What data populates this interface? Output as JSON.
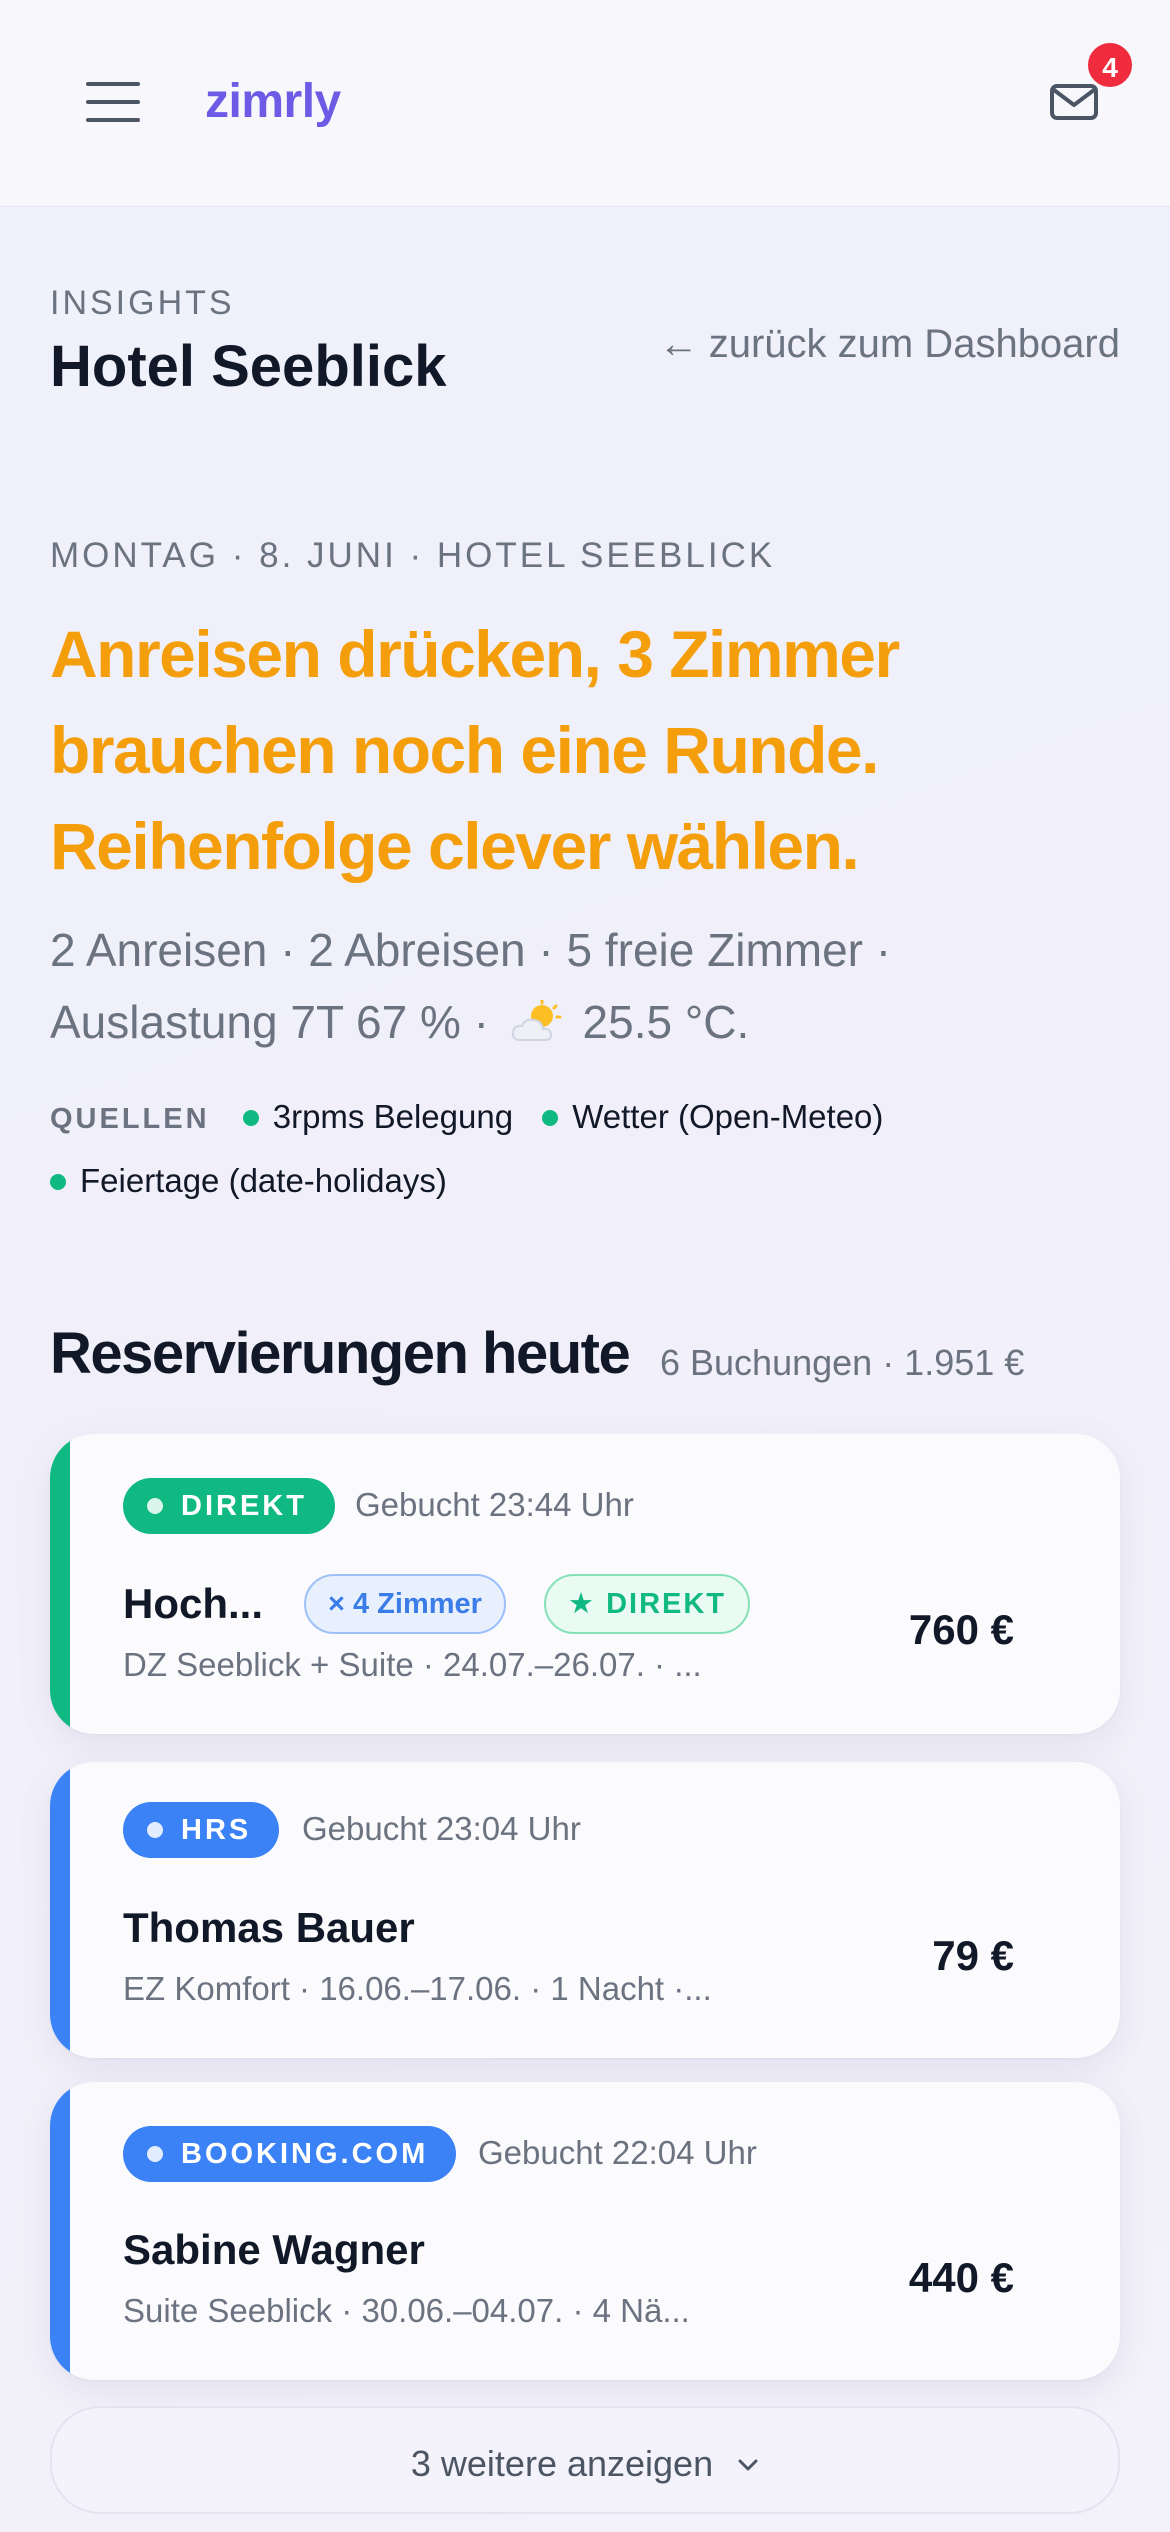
{
  "app": {
    "logo": "zimrly",
    "unread_count": "4"
  },
  "page": {
    "eyebrow": "INSIGHTS",
    "title": "Hotel Seeblick",
    "back_label": "zurück zum Dashboard"
  },
  "insight": {
    "date_line": "MONTAG · 8. JUNI · HOTEL SEEBLICK",
    "headline": "Anreisen drücken, 3 Zimmer brauchen noch eine Runde. Reihenfolge clever wählen.",
    "summary_part1": "2 Anreisen · 2 Abreisen · 5 freie Zimmer · Auslastung 7T 67 % ·",
    "summary_part2": "25.5 °C.",
    "weather_icon": "partly-cloudy-icon",
    "sources_label": "QUELLEN",
    "sources": [
      "3rpms Belegung",
      "Wetter (Open-Meteo)",
      "Feiertage (date-holidays)"
    ]
  },
  "reservations": {
    "title": "Reservierungen heute",
    "meta": "6 Buchungen · 1.951 €",
    "items": [
      {
        "channel": "DIREKT",
        "channel_color": "#10b981",
        "booked": "Gebucht 23:44 Uhr",
        "guest": "Hoch...",
        "rooms_tag": "× 4 Zimmer",
        "direct_tag": "DIREKT",
        "detail": "DZ Seeblick + Suite · 24.07.–26.07. · ...",
        "price": "760 €"
      },
      {
        "channel": "HRS",
        "channel_color": "#3b82f6",
        "booked": "Gebucht 23:04 Uhr",
        "guest": "Thomas Bauer",
        "detail": "EZ Komfort · 16.06.–17.06. · 1 Nacht ·...",
        "price": "79 €"
      },
      {
        "channel": "BOOKING.COM",
        "channel_color": "#3b82f6",
        "booked": "Gebucht 22:04 Uhr",
        "guest": "Sabine Wagner",
        "detail": "Suite Seeblick · 30.06.–04.07. · 4 Nä...",
        "price": "440 €"
      }
    ],
    "show_more": "3 weitere anzeigen"
  }
}
